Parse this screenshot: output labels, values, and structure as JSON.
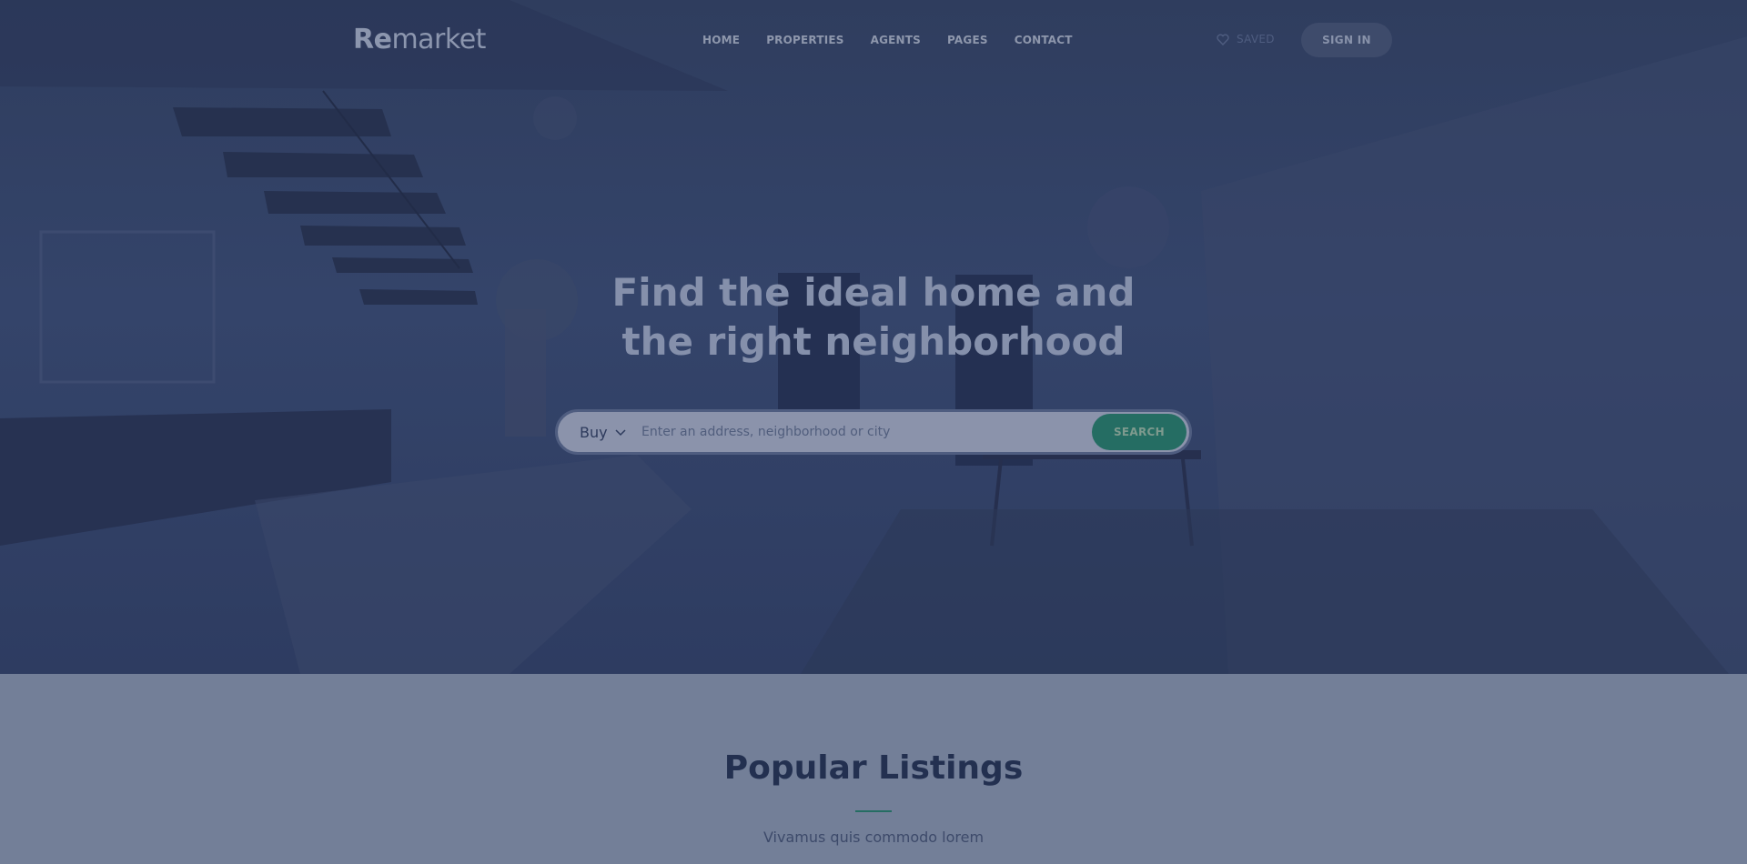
{
  "brand": {
    "logo_bold": "Re",
    "logo_rest": "market"
  },
  "nav": {
    "items": [
      {
        "label": "HOME"
      },
      {
        "label": "PROPERTIES"
      },
      {
        "label": "AGENTS"
      },
      {
        "label": "PAGES"
      },
      {
        "label": "CONTACT"
      }
    ]
  },
  "header": {
    "saved_label": "SAVED",
    "saved_icon": "heart-icon",
    "signin_label": "SIGN IN"
  },
  "hero": {
    "headline_line1": "Find the ideal home and",
    "headline_line2": "the right neighborhood"
  },
  "search": {
    "mode_value": "Buy",
    "placeholder": "Enter an address, neighborhood or city",
    "button_label": "SEARCH"
  },
  "listings": {
    "title": "Popular Listings",
    "subtitle": "Vivamus quis commodo lorem"
  },
  "colors": {
    "overlay": "#2f3d5e",
    "accent": "#256d63",
    "section_bg": "#737f98"
  }
}
